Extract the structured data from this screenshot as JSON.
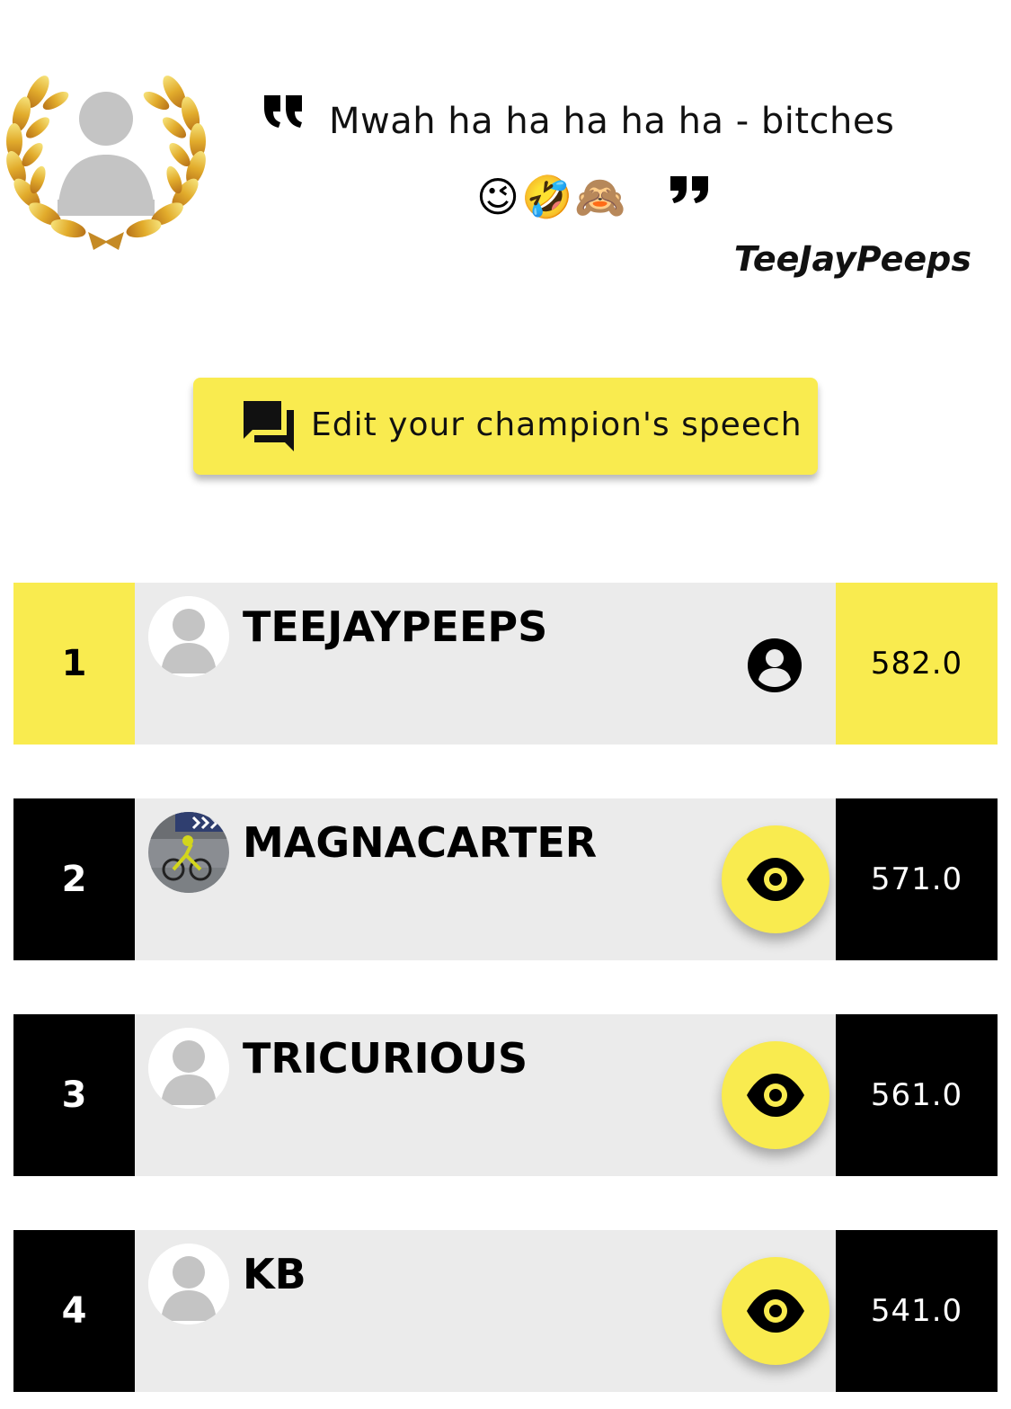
{
  "champion": {
    "quote_text": "Mwah ha ha ha ha ha - bitches",
    "quote_emojis": "😉🤣🙈",
    "author": "TeeJayPeeps"
  },
  "edit_button": {
    "label": "Edit your champion's speech",
    "icon": "forum-icon"
  },
  "leaderboard": {
    "rows": [
      {
        "rank": "1",
        "name": "TEEJAYPEEPS",
        "score": "582.0",
        "action_icon": "profile-icon",
        "avatar": "default-avatar"
      },
      {
        "rank": "2",
        "name": "MAGNACARTER",
        "score": "571.0",
        "action_icon": "eye-icon",
        "avatar": "cyclist-photo"
      },
      {
        "rank": "3",
        "name": "TRICURIOUS",
        "score": "561.0",
        "action_icon": "eye-icon",
        "avatar": "default-avatar"
      },
      {
        "rank": "4",
        "name": "KB",
        "score": "541.0",
        "action_icon": "eye-icon",
        "avatar": "default-avatar"
      }
    ]
  },
  "colors": {
    "accent_yellow": "#f9eb4f",
    "rank_black": "#000000",
    "row_gray": "#ebebeb"
  }
}
